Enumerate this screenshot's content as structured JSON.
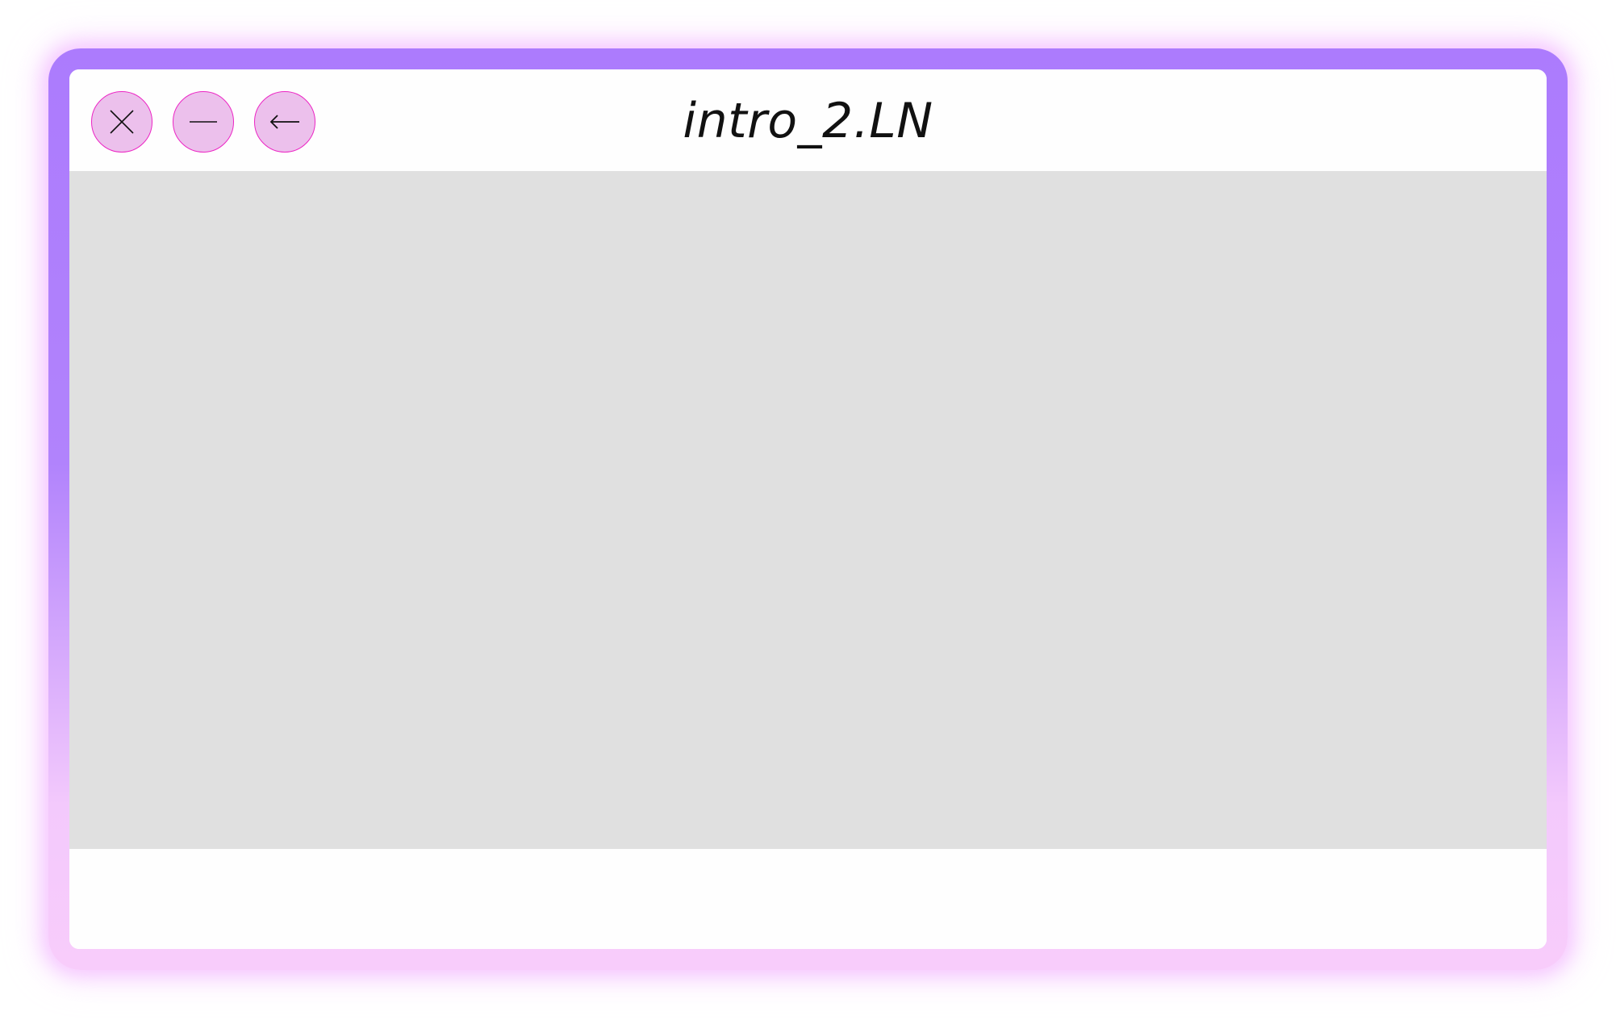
{
  "window": {
    "title": "intro_2.LN",
    "controls": [
      {
        "name": "close",
        "icon": "close-icon"
      },
      {
        "name": "minimize",
        "icon": "minimize-icon"
      },
      {
        "name": "back",
        "icon": "back-arrow-icon"
      }
    ],
    "colors": {
      "frame_top": "#ac7bfd",
      "frame_bottom": "#f8ccfb",
      "button_fill": "#ecc0ec",
      "button_border": "#ec24c4",
      "content_background": "#e0e0e0",
      "window_background": "#fefefe"
    }
  }
}
